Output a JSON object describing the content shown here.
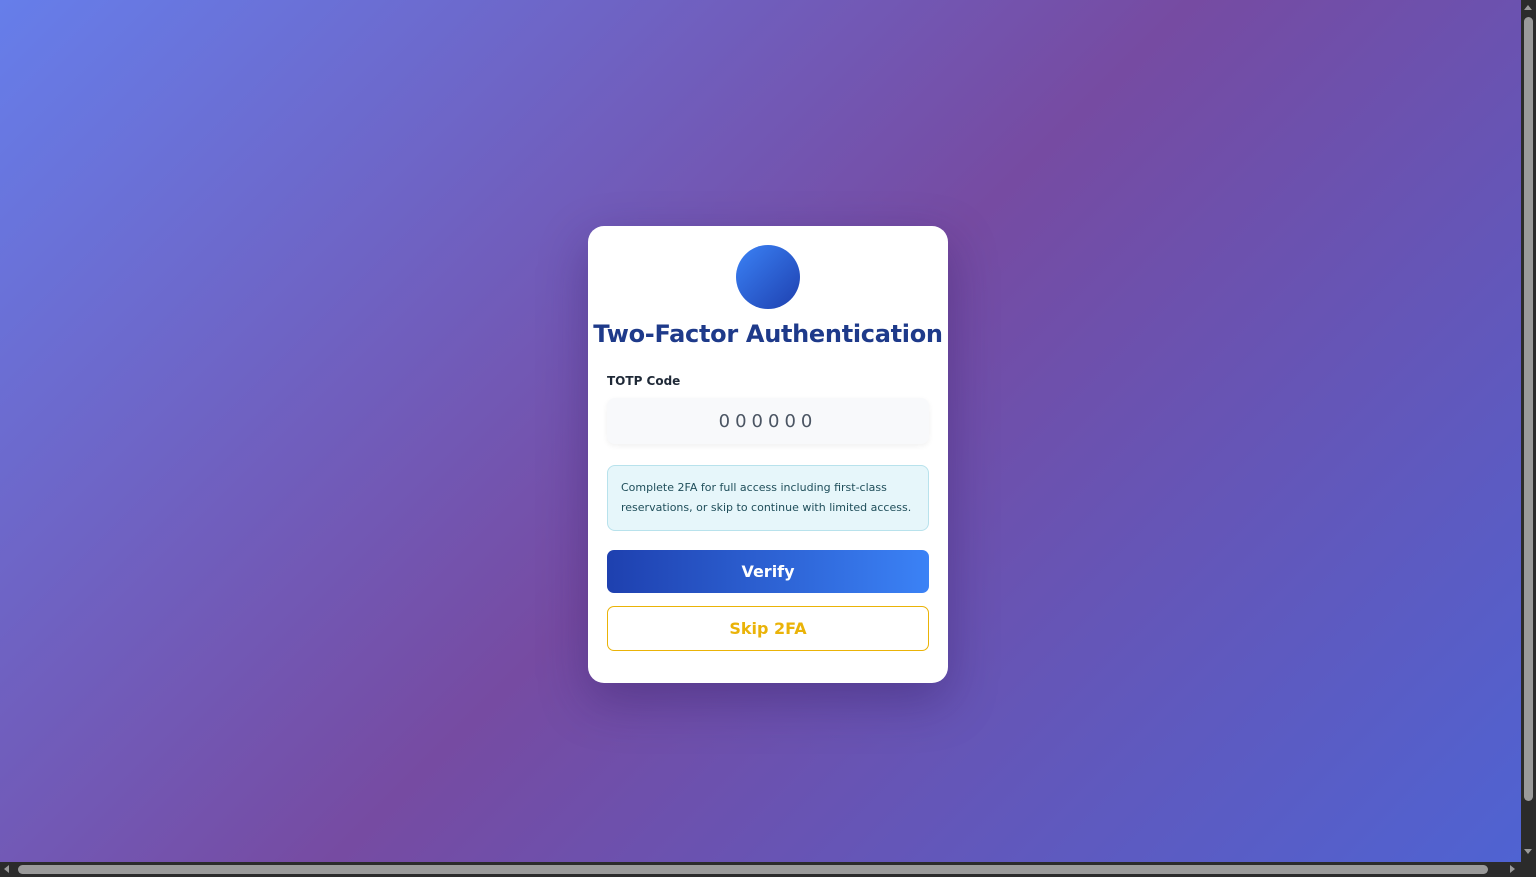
{
  "page": {
    "background_colors": [
      "#667eea",
      "#764ba2",
      "#4f63d2"
    ]
  },
  "card": {
    "logo_icon": "app-logo-icon",
    "title": "Two-Factor Authentication",
    "totp_label": "TOTP Code",
    "totp_input": {
      "value": "",
      "placeholder": "000000"
    },
    "info_text": "Complete 2FA for full access including first-class reservations, or skip to continue with limited access.",
    "verify_label": "Verify",
    "skip_label": "Skip 2FA"
  },
  "colors": {
    "title": "#1e3a8a",
    "primary_gradient_start": "#1e40af",
    "primary_gradient_end": "#3b82f6",
    "skip_accent": "#eab308",
    "info_bg": "#e6f6fa"
  }
}
